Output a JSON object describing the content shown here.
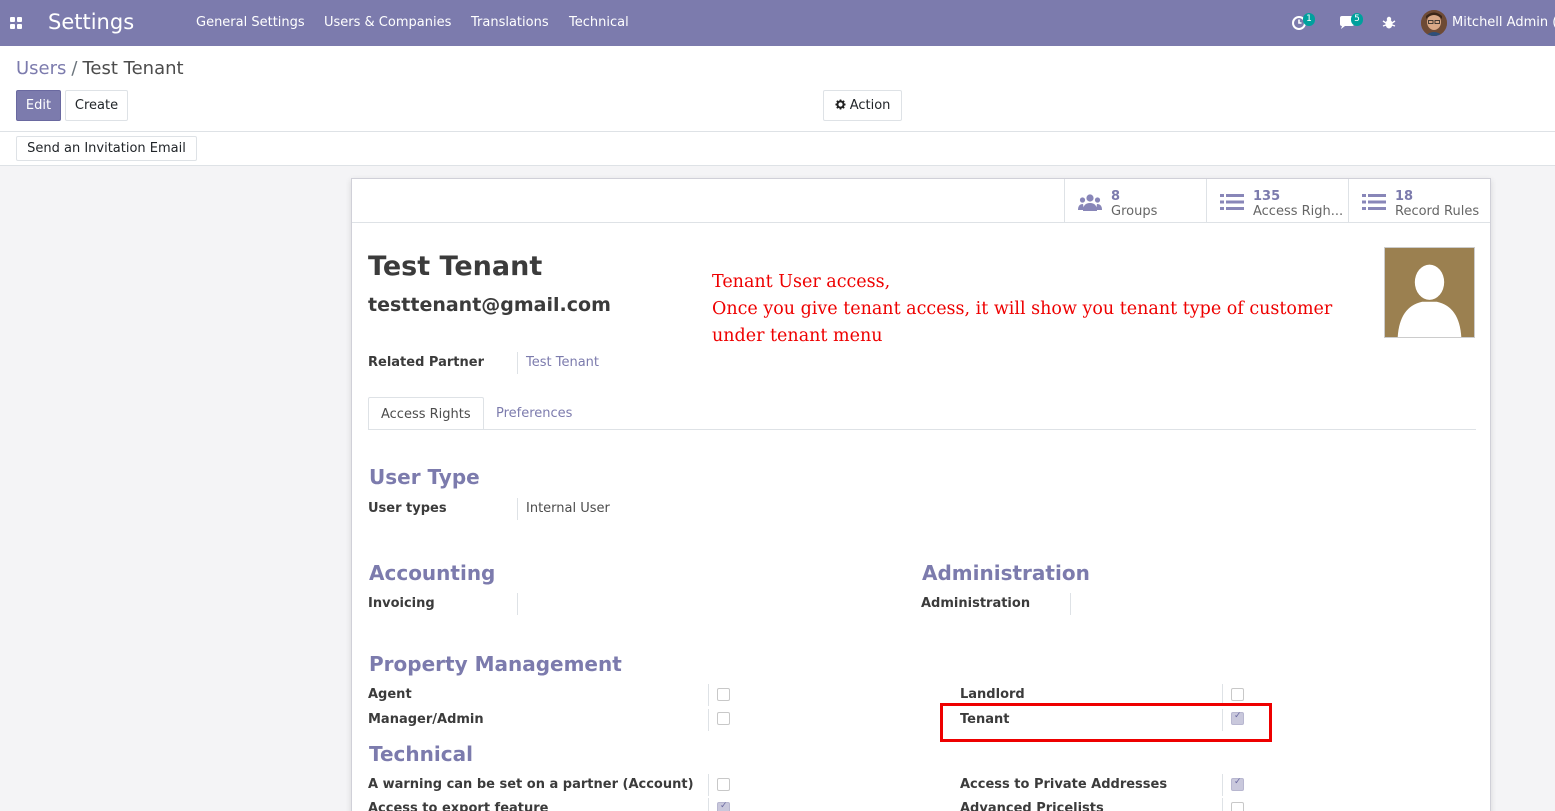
{
  "navbar": {
    "app_title": "Settings",
    "menu": [
      "General Settings",
      "Users & Companies",
      "Translations",
      "Technical"
    ],
    "activity_count": "1",
    "messages_count": "5",
    "user_name": "Mitchell Admin ("
  },
  "breadcrumb": {
    "parent": "Users",
    "separator": "/",
    "current": "Test Tenant"
  },
  "buttons": {
    "edit": "Edit",
    "create": "Create",
    "action": "Action",
    "send_invitation": "Send an Invitation Email"
  },
  "stat_buttons": [
    {
      "value": "8",
      "label": "Groups",
      "icon": "users-icon"
    },
    {
      "value": "135",
      "label": "Access Righ...",
      "icon": "list-icon"
    },
    {
      "value": "18",
      "label": "Record Rules",
      "icon": "list-icon"
    }
  ],
  "record": {
    "name": "Test Tenant",
    "email": "testtenant@gmail.com",
    "related_partner_label": "Related Partner",
    "related_partner_value": "Test Tenant"
  },
  "annotation": {
    "line1": "Tenant User access,",
    "line2": "Once you give tenant access, it will show you tenant type of customer",
    "line3": "under tenant menu"
  },
  "tabs": [
    {
      "label": "Access Rights",
      "active": true
    },
    {
      "label": "Preferences",
      "active": false
    }
  ],
  "user_type": {
    "title": "User Type",
    "label": "User types",
    "value": "Internal User"
  },
  "accounting": {
    "title": "Accounting",
    "label": "Invoicing",
    "value": ""
  },
  "administration": {
    "title": "Administration",
    "label": "Administration",
    "value": ""
  },
  "property_management": {
    "title": "Property Management",
    "left": [
      {
        "label": "Agent",
        "checked": false
      },
      {
        "label": "Manager/Admin",
        "checked": false
      }
    ],
    "right": [
      {
        "label": "Landlord",
        "checked": false
      },
      {
        "label": "Tenant",
        "checked": true
      }
    ]
  },
  "technical": {
    "title": "Technical",
    "left": [
      {
        "label": "A warning can be set on a partner (Account)",
        "checked": false
      },
      {
        "label": "Access to export feature",
        "checked": true
      }
    ],
    "right": [
      {
        "label": "Access to Private Addresses",
        "checked": true
      },
      {
        "label": "Advanced Pricelists",
        "checked": false
      }
    ]
  },
  "colors": {
    "brand": "#7c7bad",
    "annotation": "#ee0000",
    "badge": "#00a09d"
  }
}
